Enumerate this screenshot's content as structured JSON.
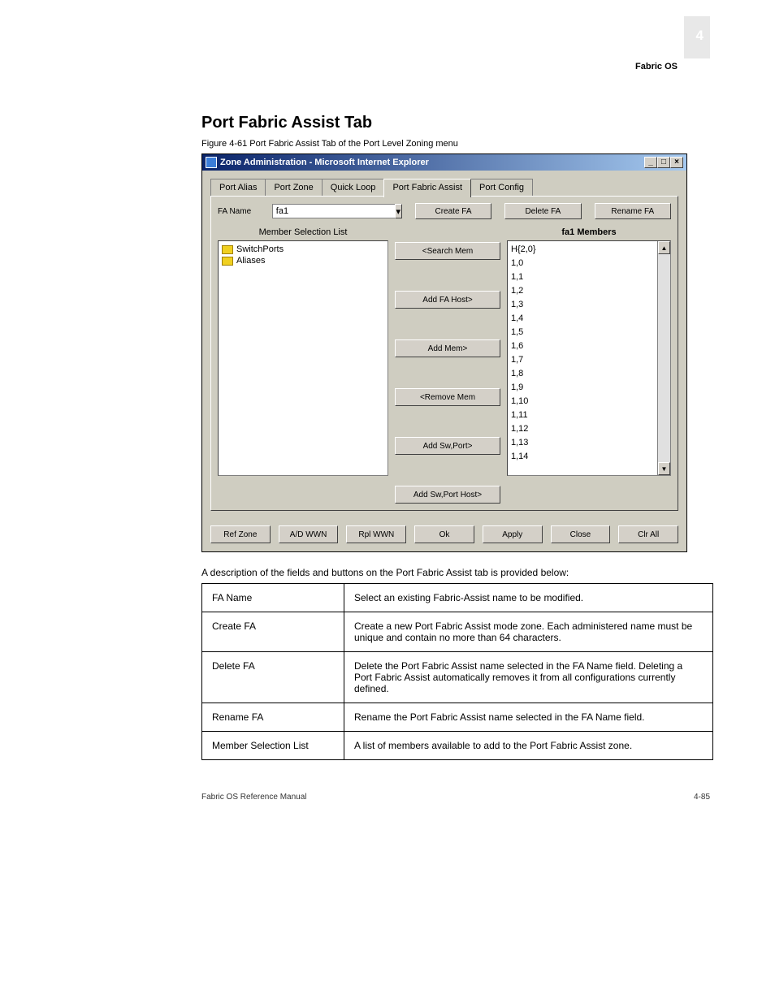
{
  "page_number": "4",
  "doc_title": "Fabric OS",
  "heading": "Port Fabric Assist Tab",
  "figure_caption": "Figure 4-61 Port Fabric Assist Tab of the Port Level Zoning menu",
  "window": {
    "title": "Zone Administration - Microsoft Internet Explorer",
    "tabs": [
      "Port Alias",
      "Port Zone",
      "Quick Loop",
      "Port Fabric Assist",
      "Port Config"
    ],
    "active_tab": 3,
    "fa_name_label": "FA Name",
    "fa_name_value": "fa1",
    "buttons": {
      "create": "Create FA",
      "delete": "Delete FA",
      "rename": "Rename FA",
      "search": "<Search Mem",
      "add_host": "Add FA Host>",
      "add_mem": "Add Mem>",
      "remove": "<Remove Mem",
      "add_swport": "Add Sw,Port>",
      "add_swport_host": "Add Sw,Port Host>",
      "ref_zone": "Ref Zone",
      "ad_wwn": "A/D WWN",
      "rpl_wwn": "Rpl WWN",
      "ok": "Ok",
      "apply": "Apply",
      "close": "Close",
      "clr_all": "Clr All"
    },
    "left_list_label": "Member Selection List",
    "right_list_label": "fa1 Members",
    "tree": [
      "SwitchPorts",
      "Aliases"
    ],
    "members": [
      "H{2,0}",
      "1,0",
      "1,1",
      "1,2",
      "1,3",
      "1,4",
      "1,5",
      "1,6",
      "1,7",
      "1,8",
      "1,9",
      "1,10",
      "1,11",
      "1,12",
      "1,13",
      "1,14"
    ]
  },
  "desc_intro": "A description of the fields and buttons on the Port Fabric Assist tab is provided below:",
  "table": [
    {
      "f": "FA Name",
      "d": "Select an existing Fabric-Assist name to be modified."
    },
    {
      "f": "Create FA",
      "d": "Create a new Port Fabric Assist mode zone. Each administered name must be unique and contain no more than 64 characters."
    },
    {
      "f": "Delete FA",
      "d": "Delete the Port Fabric Assist name selected in the FA Name field. Deleting a Port Fabric Assist automatically removes it from all configurations currently defined."
    },
    {
      "f": "Rename FA",
      "d": "Rename the Port Fabric Assist name selected in the FA Name field."
    },
    {
      "f": "Member Selection List",
      "d": "A list of members available to add to the Port Fabric Assist zone."
    }
  ],
  "footer_left": "Fabric OS Reference Manual",
  "footer_right": "4-85"
}
